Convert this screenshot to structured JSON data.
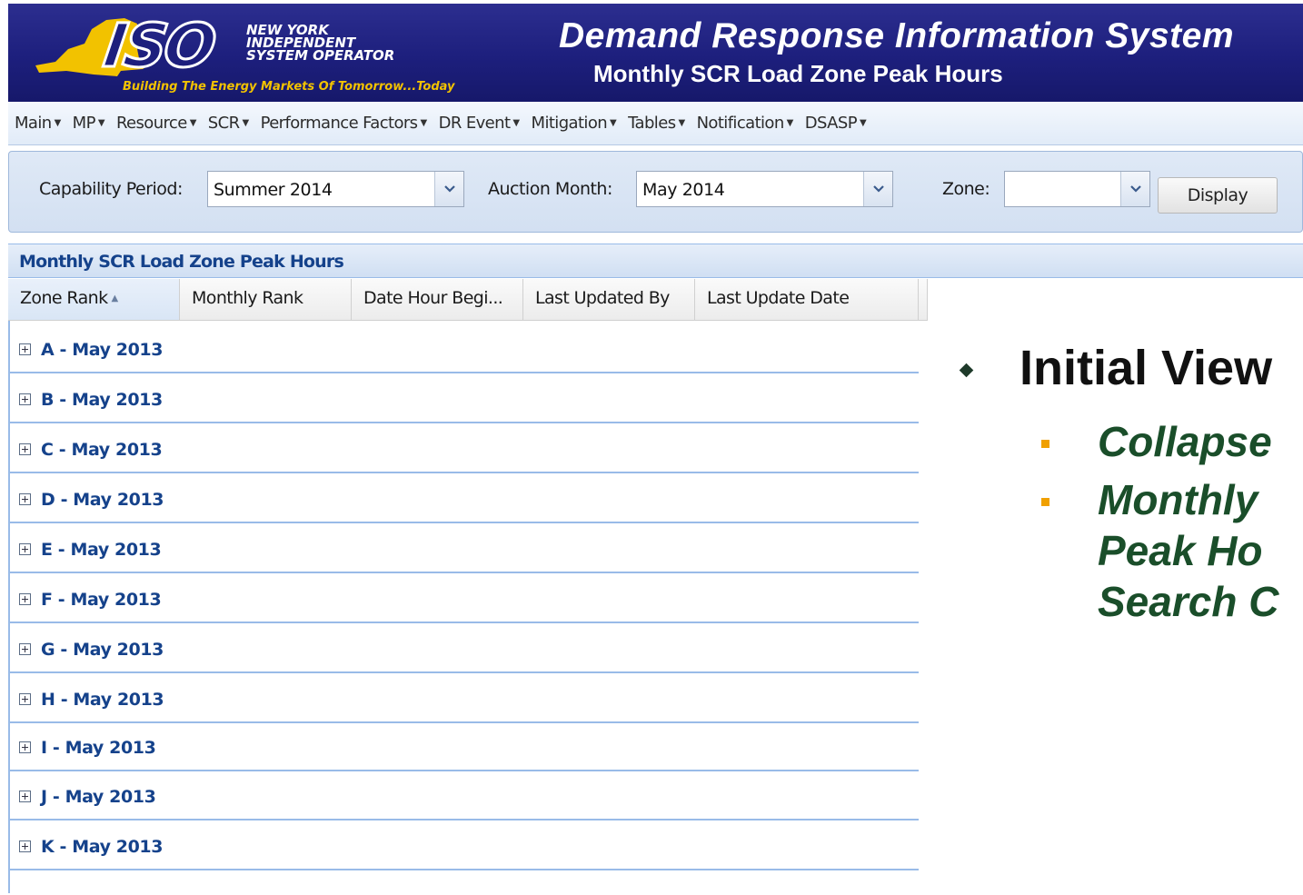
{
  "header": {
    "logo_text": "ISO",
    "org_name_lines": [
      "NEW YORK",
      "INDEPENDENT",
      "SYSTEM OPERATOR"
    ],
    "tagline": "Building The Energy Markets Of Tomorrow...Today",
    "app_title": "Demand Response Information System",
    "page_subtitle": "Monthly SCR Load Zone Peak Hours"
  },
  "menu": {
    "items": [
      {
        "label": "Main"
      },
      {
        "label": "MP"
      },
      {
        "label": "Resource"
      },
      {
        "label": "SCR"
      },
      {
        "label": "Performance Factors"
      },
      {
        "label": "DR Event"
      },
      {
        "label": "Mitigation"
      },
      {
        "label": "Tables"
      },
      {
        "label": "Notification"
      },
      {
        "label": "DSASP"
      }
    ]
  },
  "filters": {
    "capability_period": {
      "label": "Capability Period:",
      "value": "Summer 2014"
    },
    "auction_month": {
      "label": "Auction Month:",
      "value": "May 2014"
    },
    "zone": {
      "label": "Zone:",
      "value": ""
    },
    "display_button": "Display"
  },
  "grid": {
    "title": "Monthly SCR Load Zone Peak Hours",
    "columns": [
      {
        "label": "Zone Rank",
        "sort": "ascending"
      },
      {
        "label": "Monthly Rank"
      },
      {
        "label": "Date Hour Begi..."
      },
      {
        "label": "Last Updated By"
      },
      {
        "label": "Last Update Date"
      }
    ],
    "groups": [
      {
        "label": "A - May 2013"
      },
      {
        "label": "B - May 2013"
      },
      {
        "label": "C - May 2013"
      },
      {
        "label": "D - May 2013"
      },
      {
        "label": "E - May 2013"
      },
      {
        "label": "F - May 2013"
      },
      {
        "label": "G - May 2013"
      },
      {
        "label": "H - May 2013"
      },
      {
        "label": "I - May 2013"
      },
      {
        "label": "J - May 2013"
      },
      {
        "label": "K - May 2013"
      }
    ]
  },
  "annotation": {
    "main_bullet": "Initial View",
    "sub_bullets": [
      {
        "lines": [
          "Collapse"
        ]
      },
      {
        "lines": [
          "Monthly",
          "Peak Ho",
          "Search C"
        ]
      }
    ]
  },
  "colors": {
    "header_bg": "#1d1f7d",
    "tagline": "#f2c200",
    "grid_text": "#15428b",
    "row_border": "#99bbe8",
    "sub_bullet_text": "#1a4e2a",
    "sub_bullet_marker": "#f0a000"
  }
}
